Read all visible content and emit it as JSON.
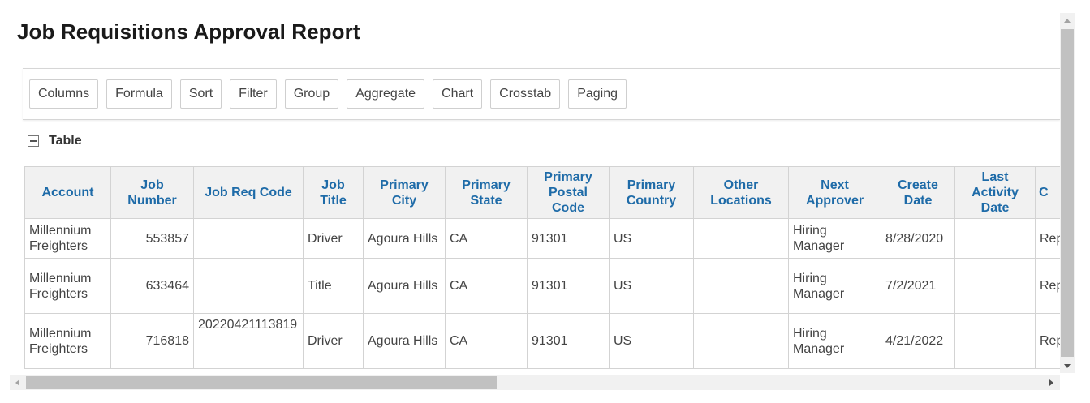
{
  "page": {
    "title": "Job Requisitions Approval Report"
  },
  "toolbar": {
    "buttons": [
      "Columns",
      "Formula",
      "Sort",
      "Filter",
      "Group",
      "Aggregate",
      "Chart",
      "Crosstab",
      "Paging"
    ]
  },
  "section": {
    "label": "Table",
    "icon": "collapse-minus-icon"
  },
  "table": {
    "headers": [
      "Account",
      "Job Number",
      "Job Req Code",
      "Job Title",
      "Primary City",
      "Primary State",
      "Primary Postal Code",
      "Primary Country",
      "Other Locations",
      "Next Approver",
      "Create Date",
      "Last Activity Date",
      "C"
    ],
    "rows": [
      [
        "Millennium Freighters",
        "553857",
        "",
        "Driver",
        "Agoura Hills",
        "CA",
        "91301",
        "US",
        "",
        "Hiring Manager",
        "8/28/2020",
        "",
        "Rep Job"
      ],
      [
        "Millennium Freighters",
        "633464",
        "",
        "Title",
        "Agoura Hills",
        "CA",
        "91301",
        "US",
        "",
        "Hiring Manager",
        "7/2/2021",
        "",
        "Rep Job"
      ],
      [
        "Millennium Freighters",
        "716818",
        "20220421113819",
        "Driver",
        "Agoura Hills",
        "CA",
        "91301",
        "US",
        "",
        "Hiring Manager",
        "4/21/2022",
        "",
        "Rep Job"
      ]
    ]
  },
  "colors": {
    "header_text": "#1e6ba8",
    "header_bg": "#f1f1f1",
    "border": "#d3d3d3"
  }
}
